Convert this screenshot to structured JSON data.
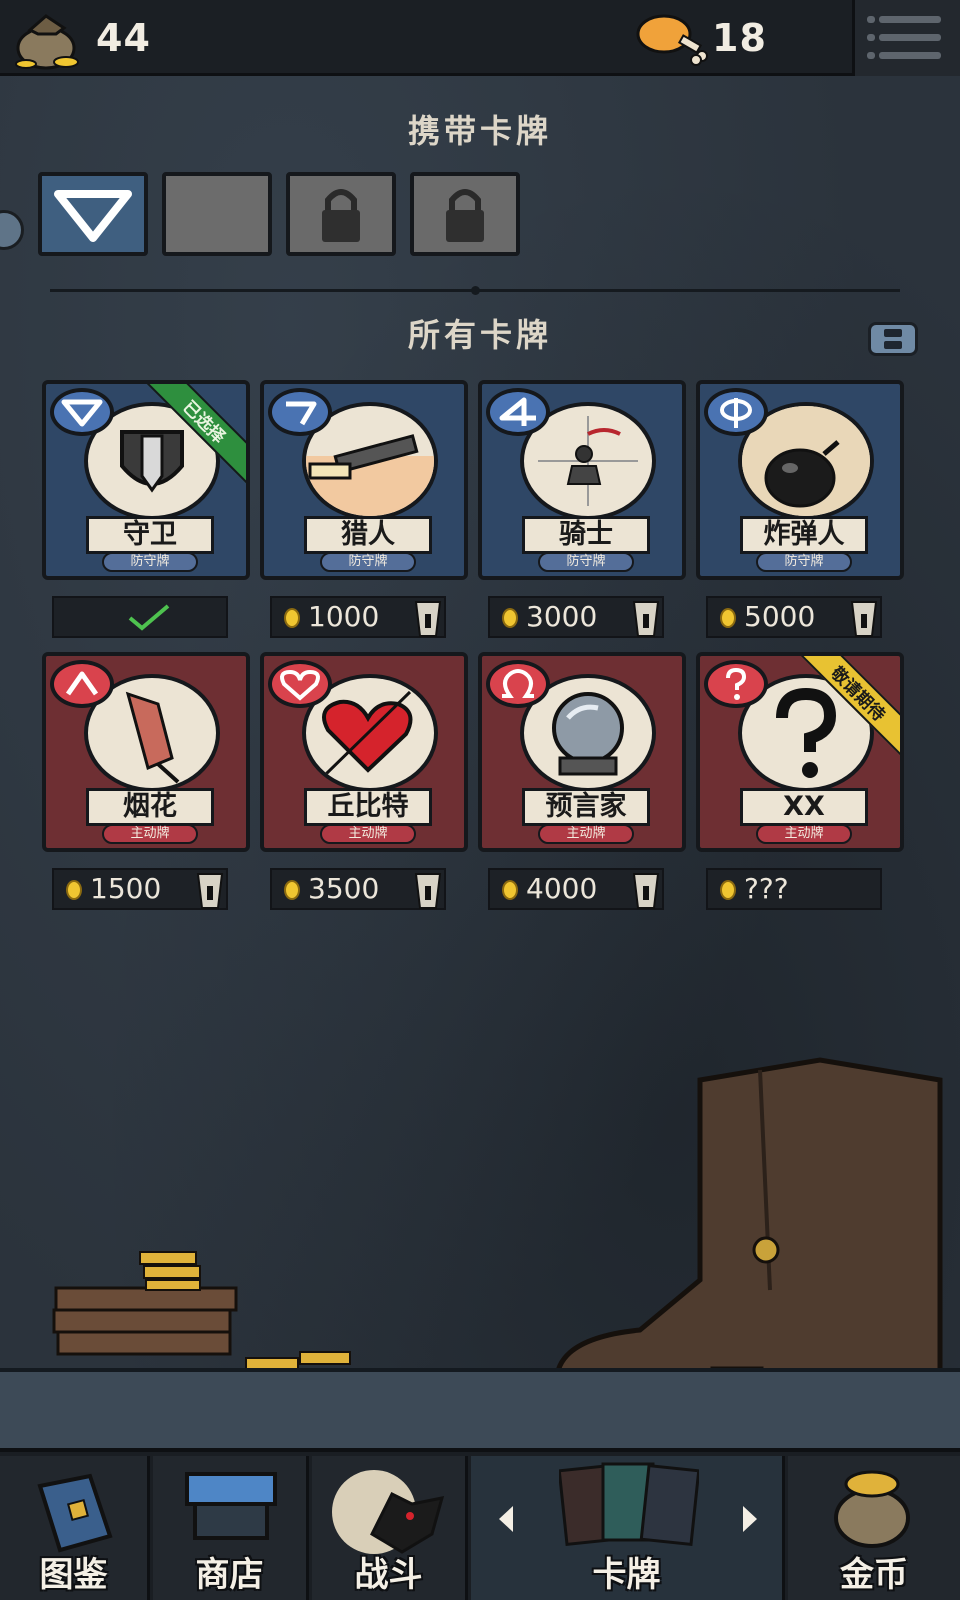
{
  "currency": {
    "coins": "44",
    "food": "18"
  },
  "equipped": {
    "title": "携带卡牌",
    "slots": [
      "filled",
      "empty",
      "locked",
      "locked"
    ]
  },
  "all_cards": {
    "title": "所有卡牌",
    "cards": [
      {
        "name": "守卫",
        "type": "防守牌",
        "price": "",
        "status": "selected",
        "ribbon": "已选择",
        "symbol": "triangle-down"
      },
      {
        "name": "猎人",
        "type": "防守牌",
        "price": "1000",
        "status": "locked",
        "ribbon": "",
        "symbol": "seven"
      },
      {
        "name": "骑士",
        "type": "防守牌",
        "price": "3000",
        "status": "locked",
        "ribbon": "",
        "symbol": "four"
      },
      {
        "name": "炸弹人",
        "type": "防守牌",
        "price": "5000",
        "status": "locked",
        "ribbon": "",
        "symbol": "phi"
      },
      {
        "name": "烟花",
        "type": "主动牌",
        "price": "1500",
        "status": "locked",
        "ribbon": "",
        "symbol": "caret-up"
      },
      {
        "name": "丘比特",
        "type": "主动牌",
        "price": "3500",
        "status": "locked",
        "ribbon": "",
        "symbol": "heart"
      },
      {
        "name": "预言家",
        "type": "主动牌",
        "price": "4000",
        "status": "locked",
        "ribbon": "",
        "symbol": "omega"
      },
      {
        "name": "XX",
        "type": "主动牌",
        "price": "???",
        "status": "coming",
        "ribbon": "敬请期待",
        "symbol": "question"
      }
    ]
  },
  "nav": {
    "items": [
      {
        "label": "图鉴",
        "icon": "book-icon"
      },
      {
        "label": "商店",
        "icon": "shop-icon"
      },
      {
        "label": "战斗",
        "icon": "battle-icon"
      },
      {
        "label": "卡牌",
        "icon": "cards-icon",
        "active": true
      },
      {
        "label": "金币",
        "icon": "coin-bag-icon"
      }
    ]
  },
  "colors": {
    "defense_card": "#2f4766",
    "active_card": "#6e2f33",
    "selected_ribbon": "#2e8f3e",
    "coming_ribbon": "#e8c232",
    "coin": "#f0c631"
  }
}
